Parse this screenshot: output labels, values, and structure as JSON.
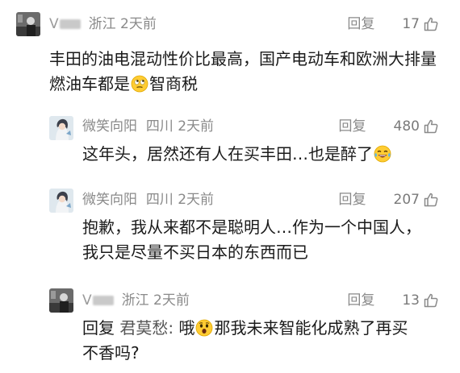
{
  "comments": [
    {
      "name": "V",
      "location": "浙江",
      "time": "2天前",
      "reply_label": "回复",
      "likes": "17",
      "text_before": "丰田的油电混动性价比最高，国产电动车和欧洲大排量燃油车都是",
      "emoji": "rolling-eyes-emoji",
      "text_after": "智商税"
    },
    {
      "name": "微笑向阳",
      "location": "四川",
      "time": "2天前",
      "reply_label": "回复",
      "likes": "480",
      "text_before": "这年头，居然还有人在买丰田…也是醉了",
      "emoji": "tears-of-joy-emoji",
      "text_after": ""
    },
    {
      "name": "微笑向阳",
      "location": "四川",
      "time": "2天前",
      "reply_label": "回复",
      "likes": "207",
      "text": "抱歉，我从来都不是聪明人…作为一个中国人，我只是尽量不买日本的东西而已"
    },
    {
      "name": "V",
      "location": "浙江",
      "time": "2天前",
      "reply_label": "回复",
      "likes": "13",
      "reply_prefix": "回复",
      "reply_to": "君莫愁:",
      "text_before": "哦",
      "emoji": "surprised-face-emoji",
      "text_after": "那我未来智能化成熟了再买不香吗?"
    }
  ]
}
